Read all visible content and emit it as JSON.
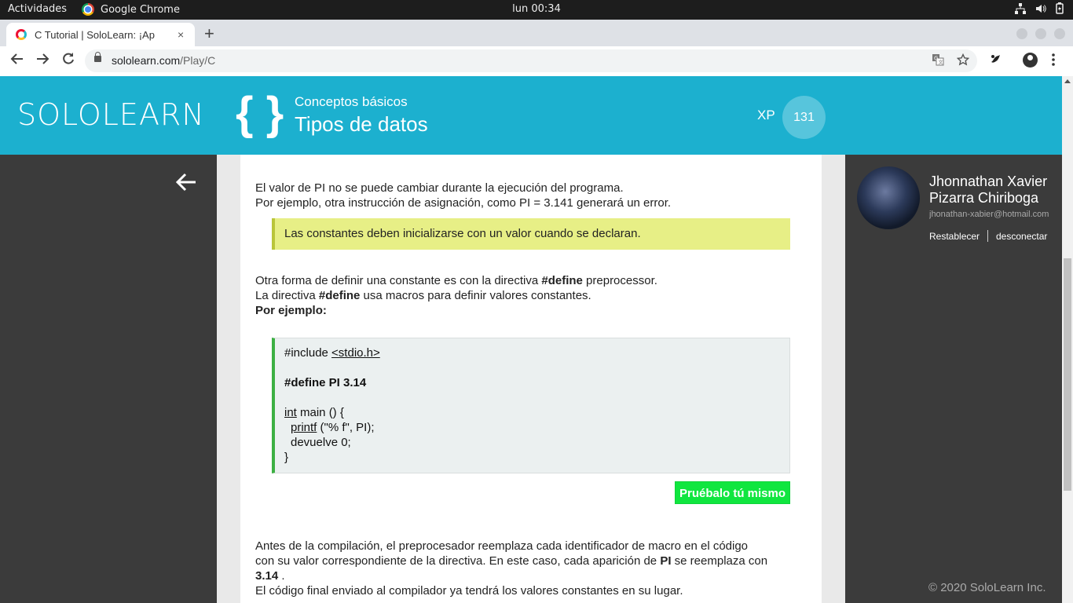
{
  "os_bar": {
    "activities": "Actividades",
    "app_name": "Google Chrome",
    "clock": "lun 00:34",
    "tray_icons": [
      "network-icon",
      "volume-icon",
      "battery-icon"
    ]
  },
  "browser": {
    "tab_title": "C Tutorial | SoloLearn: ¡Ap",
    "tab_close": "×",
    "new_tab": "+",
    "url_domain": "sololearn.com",
    "url_path": "/Play/C"
  },
  "header": {
    "logo": "SOLOLEARN",
    "braces": "{ }",
    "module": "Conceptos básicos",
    "lesson": "Tipos de datos",
    "xp_label": "XP",
    "xp_value": "131",
    "brand_color": "#1cb0cf"
  },
  "lesson": {
    "para1_line1": "El valor de PI no se puede cambiar durante la ejecución del programa.",
    "para1_line2": "Por ejemplo, otra instrucción de asignación, como PI = 3.141 generará un error.",
    "note": "Las constantes deben inicializarse con un valor cuando se declaran.",
    "para2_a": "Otra forma de definir una constante es con la directiva ",
    "para2_b": "#define",
    "para2_c": " preprocessor.",
    "para3_a": "La directiva ",
    "para3_b": "#define",
    "para3_c": " usa macros para definir valores constantes.",
    "example": "Por ejemplo:",
    "code": {
      "l1a": "#include ",
      "l1b": "<stdio.h>",
      "l2": "#define PI 3.14",
      "l3a": "int",
      "l3b": " main () {",
      "l4a": "printf",
      "l4b": " (\"% f\", PI);",
      "l5": "devuelve 0;",
      "l6": "}"
    },
    "try_button": "Pruébalo tú mismo",
    "para4_l1": "Antes de la compilación, el preprocesador reemplaza cada identificador de macro en el código",
    "para4_l2a": "con su valor correspondiente de la directiva. En este caso, cada aparición de ",
    "para4_l2b": "PI",
    "para4_l2c": " se reemplaza con",
    "para4_l3a": "3.14",
    "para4_l3b": " .",
    "para4_l4": "El código final enviado al compilador ya tendrá los valores constantes en su lugar."
  },
  "profile": {
    "name": "Jhonnathan Xavier Pizarra Chiriboga",
    "email": "jhonathan-xabier@hotmail.com",
    "reset": "Restablecer",
    "logout": "desconectar"
  },
  "footer": {
    "copyright": "© 2020 SoloLearn Inc."
  }
}
